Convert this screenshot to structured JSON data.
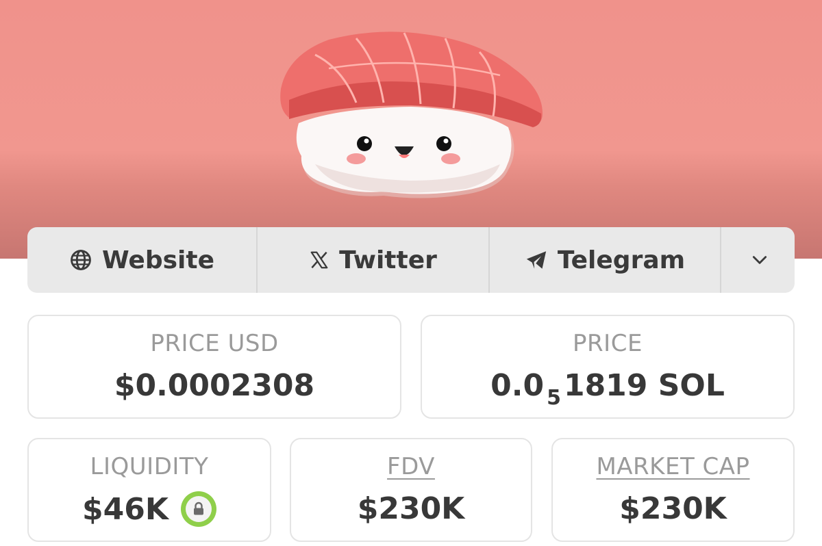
{
  "links": {
    "website": {
      "label": "Website",
      "icon": "globe-icon"
    },
    "twitter": {
      "label": "Twitter",
      "icon": "x-logo-icon"
    },
    "telegram": {
      "label": "Telegram",
      "icon": "telegram-icon"
    },
    "more": {
      "icon": "chevron-down-icon"
    }
  },
  "stats": {
    "price_usd": {
      "label": "PRICE USD",
      "value": "$0.0002308"
    },
    "price": {
      "label": "PRICE",
      "prefix": "0.0",
      "subscript": "5",
      "suffix": "1819 SOL"
    },
    "liquidity": {
      "label": "LIQUIDITY",
      "value": "$46K",
      "badge_icon": "lock-icon"
    },
    "fdv": {
      "label": "FDV",
      "value": "$230K"
    },
    "market_cap": {
      "label": "MARKET CAP",
      "value": "$230K"
    }
  },
  "colors": {
    "banner": "#f1978f",
    "lock_badge": "#8fcf4a",
    "text_dark": "#383838",
    "text_muted": "#9a9a9a"
  }
}
